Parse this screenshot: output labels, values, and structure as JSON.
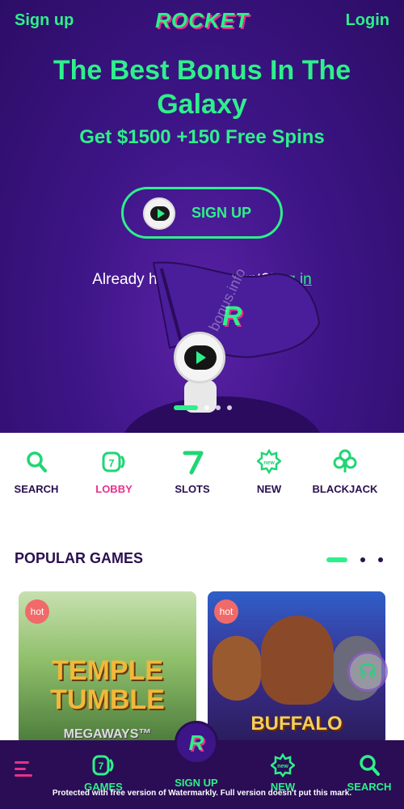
{
  "header": {
    "signup_label": "Sign up",
    "login_label": "Login",
    "logo_text": "ROCKET"
  },
  "hero": {
    "headline": "The Best Bonus In The Galaxy",
    "subline": "Get $1500 +150 Free Spins",
    "cta_label": "SIGN UP",
    "already_text": "Already have an account?",
    "login_link": "Log in",
    "flag_letter": "R",
    "watermark_text": "bonus.info",
    "carousel_active_index": 1,
    "carousel_total": 4
  },
  "categories": [
    {
      "label": "SEARCH",
      "icon": "search-icon",
      "active": false
    },
    {
      "label": "LOBBY",
      "icon": "lobby-icon",
      "active": true
    },
    {
      "label": "SLOTS",
      "icon": "slots-icon",
      "active": false
    },
    {
      "label": "NEW",
      "icon": "new-badge-icon",
      "active": false
    },
    {
      "label": "BLACKJACK",
      "icon": "club-icon",
      "active": false
    }
  ],
  "popular": {
    "title": "POPULAR GAMES",
    "games": [
      {
        "badge": "hot",
        "title_line1": "TEMPLE",
        "title_line2": "TUMBLE",
        "title_line3": "MEGAWAYS™"
      },
      {
        "badge": "hot",
        "title_line1": "BUFFALO"
      }
    ]
  },
  "bottom_nav": {
    "games_label": "GAMES",
    "signup_label": "SIGN UP",
    "new_label": "NEW",
    "search_label": "SEARCH",
    "center_letter": "R",
    "lobby_number": "7",
    "new_badge_text": "new"
  },
  "footer_notice": "Protected with free version of Watermarkly. Full version doesn't put this mark.",
  "colors": {
    "accent": "#2ef08a",
    "brand_pink": "#e8308c",
    "hero_bg": "#3d1586",
    "nav_bg": "#2a0d55"
  }
}
